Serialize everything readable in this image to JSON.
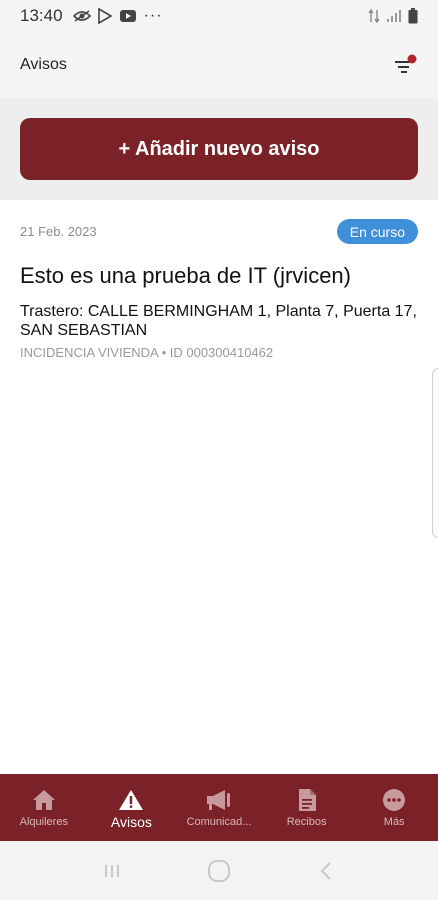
{
  "status_bar": {
    "time": "13:40",
    "icons": [
      "eye-off-icon",
      "play-store-icon",
      "youtube-icon",
      "more-dots-icon",
      "data-arrows-icon",
      "signal-icon",
      "battery-icon"
    ],
    "more": "···"
  },
  "header": {
    "title": "Avisos",
    "filter_icon": "filter-icon",
    "accent": "#7a2228"
  },
  "add_button": {
    "label": "+ Añadir nuevo aviso"
  },
  "notices": [
    {
      "date": "21 Feb. 2023",
      "status": "En curso",
      "status_color": "#3f8fd9",
      "title": "Esto es una prueba de IT (jrvicen)",
      "address": "Trastero: CALLE BERMINGHAM 1, Planta 7, Puerta 17, SAN SEBASTIAN",
      "meta": "INCIDENCIA VIVIENDA • ID 000300410462"
    }
  ],
  "bottom_nav": {
    "items": [
      {
        "label": "Alquileres",
        "icon": "home-icon"
      },
      {
        "label": "Avisos",
        "icon": "warning-icon"
      },
      {
        "label": "Comunicad...",
        "icon": "megaphone-icon"
      },
      {
        "label": "Recibos",
        "icon": "document-icon"
      },
      {
        "label": "Más",
        "icon": "more-icon"
      }
    ],
    "active_index": 1
  },
  "system_nav": [
    "recents-icon",
    "home-circle-icon",
    "back-icon"
  ]
}
